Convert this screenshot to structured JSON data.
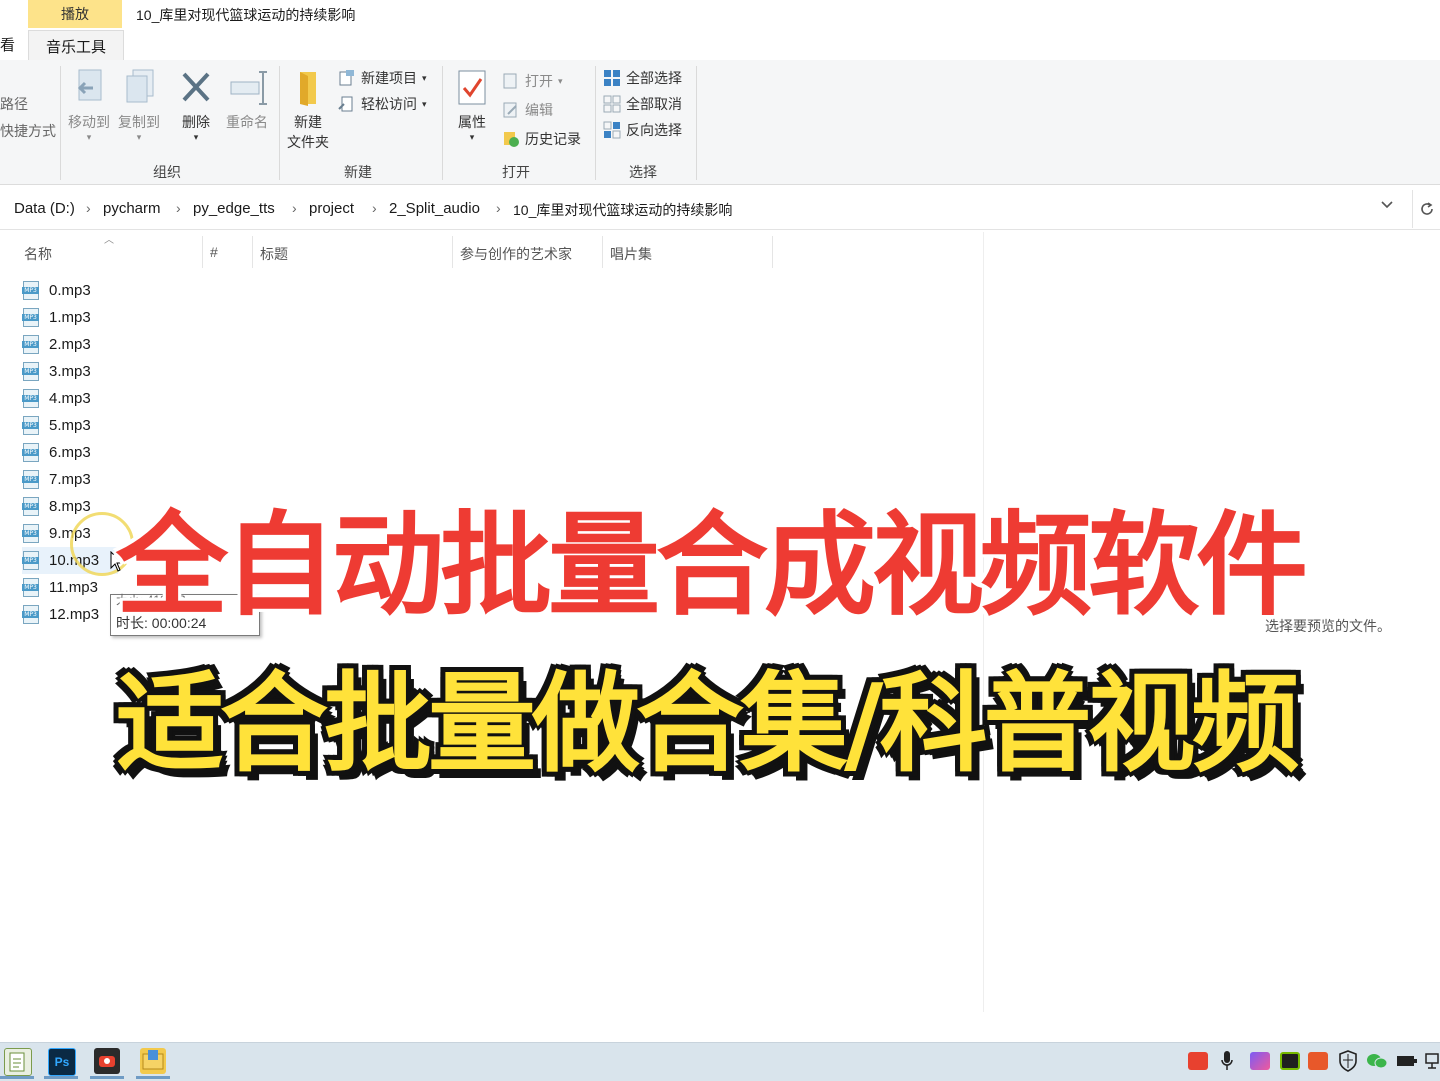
{
  "tabs": {
    "play": "播放",
    "music_tools": "音乐工具",
    "left_cut": "看"
  },
  "window_title": "10_库里对现代篮球运动的持续影响",
  "ribbon": {
    "left_partial": [
      "路径",
      "快捷方式"
    ],
    "organize": {
      "move_to": "移动到",
      "copy_to": "复制到",
      "delete": "删除",
      "rename": "重命名",
      "label": "组织"
    },
    "new": {
      "new_folder_line1": "新建",
      "new_folder_line2": "文件夹",
      "new_item": "新建项目",
      "easy_access": "轻松访问",
      "label": "新建"
    },
    "open": {
      "properties": "属性",
      "open": "打开",
      "edit": "编辑",
      "history": "历史记录",
      "label": "打开"
    },
    "select": {
      "select_all": "全部选择",
      "select_none": "全部取消",
      "invert": "反向选择",
      "label": "选择"
    }
  },
  "breadcrumb": [
    "Data (D:)",
    "pycharm",
    "py_edge_tts",
    "project",
    "2_Split_audio",
    "10_库里对现代篮球运动的持续影响"
  ],
  "columns": [
    "名称",
    "#",
    "标题",
    "参与创作的艺术家",
    "唱片集"
  ],
  "files": [
    "0.mp3",
    "1.mp3",
    "2.mp3",
    "3.mp3",
    "4.mp3",
    "5.mp3",
    "6.mp3",
    "7.mp3",
    "8.mp3",
    "9.mp3",
    "10.mp3",
    "11.mp3",
    "12.mp3"
  ],
  "file_icon_tag": "MP3",
  "tooltip": {
    "size": "大小: 412 KB",
    "duration": "时长: 00:00:24"
  },
  "preview_text": "选择要预览的文件。",
  "overlay": {
    "line1": "全自动批量合成视频软件",
    "line2": "适合批量做合集/科普视频"
  },
  "taskbar": {
    "apps": [
      "notepad-icon",
      "photoshop-icon",
      "recorder-icon",
      "explorer-icon"
    ],
    "ps_label": "Ps"
  },
  "colors": {
    "overlay_red": "#ee3b33",
    "overlay_yellow": "#ffe23a",
    "play_tab": "#fde38a",
    "taskbar": "#d9e4ec"
  }
}
